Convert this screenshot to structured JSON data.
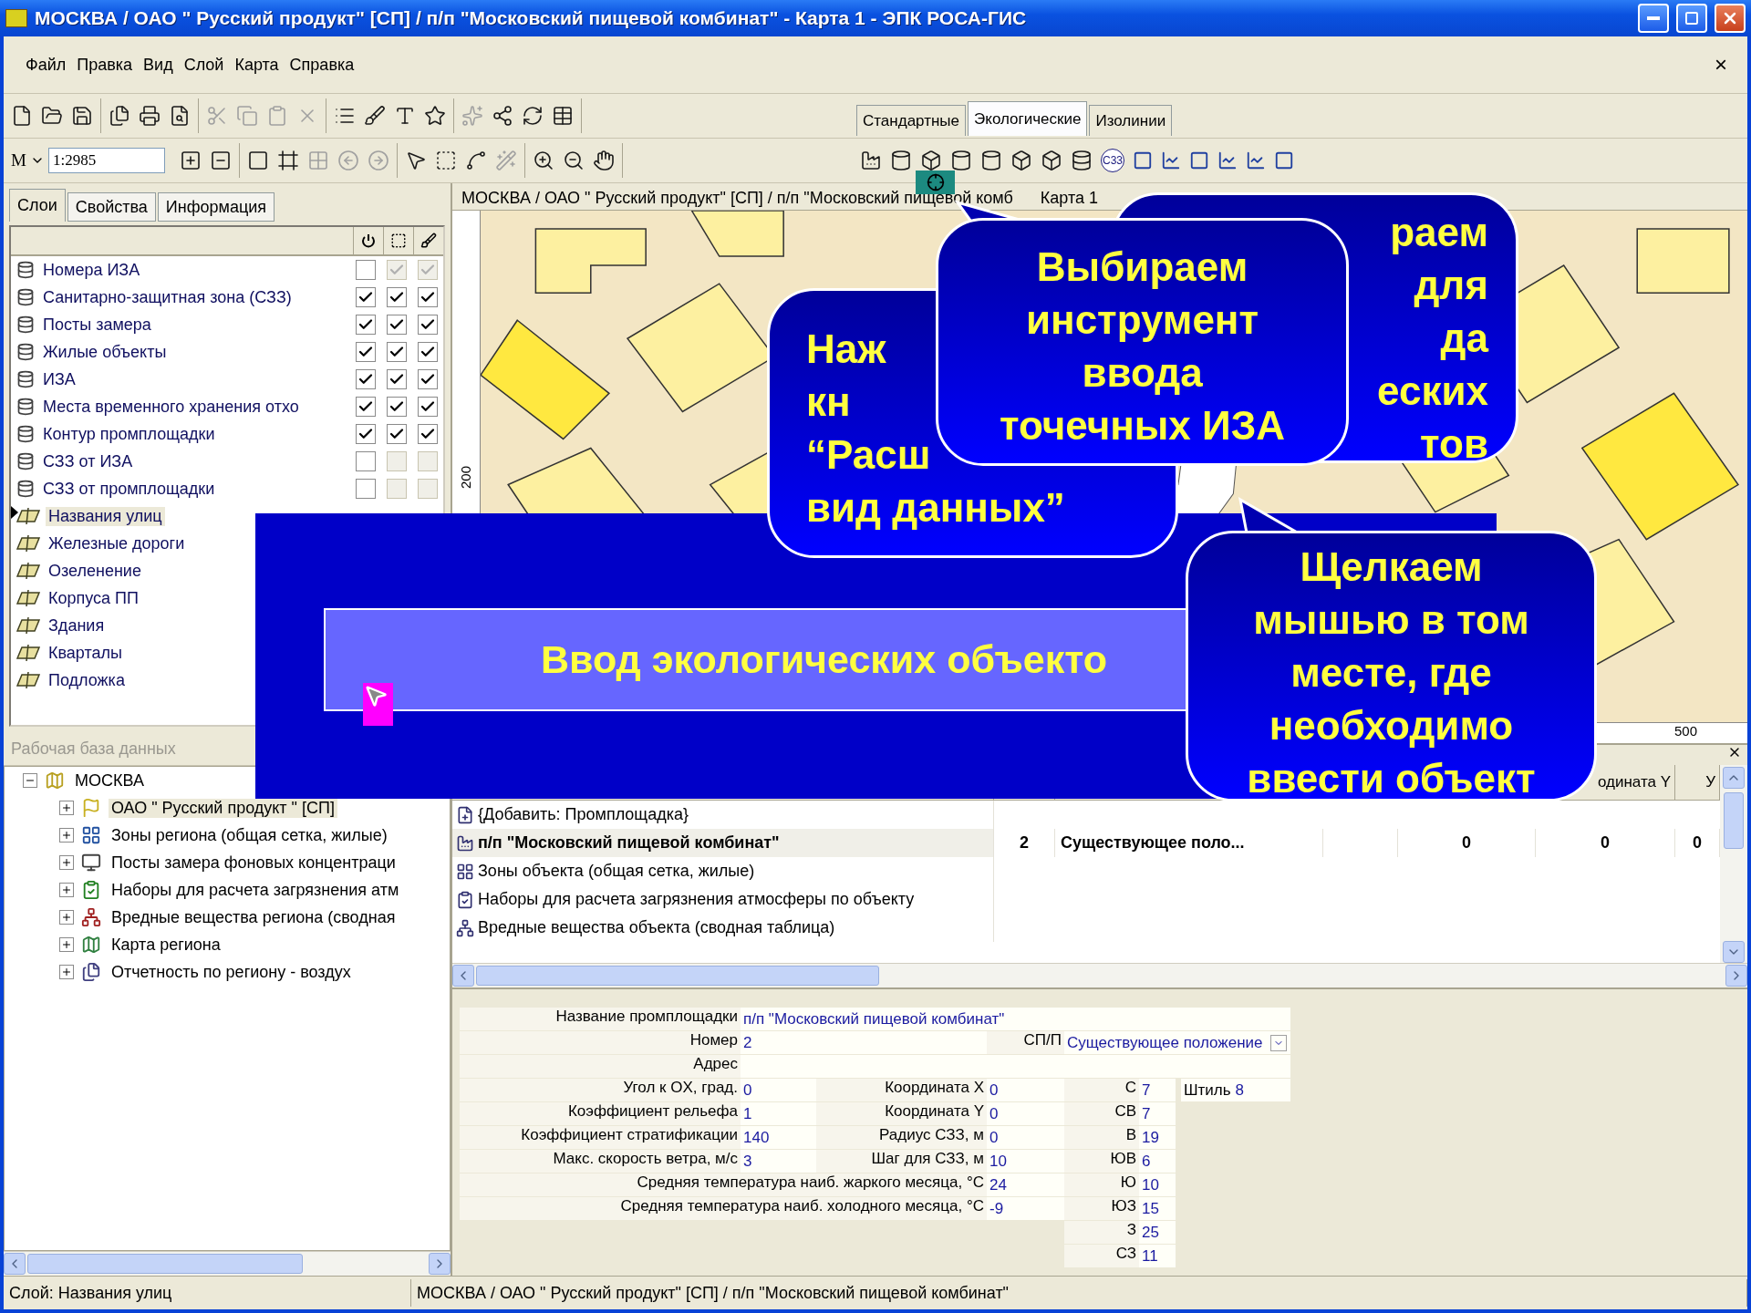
{
  "window": {
    "title": "МОСКВА / ОАО \" Русский продукт\"  [СП] / п/п \"Московский пищевой комбинат\"  -  Карта 1  -  ЭПК РОСА-ГИС"
  },
  "menu": [
    "Файл",
    "Правка",
    "Вид",
    "Слой",
    "Карта",
    "Справка"
  ],
  "menu_close": "×",
  "scale": {
    "unit": "M",
    "value": "1:2985"
  },
  "tool_tabs": [
    {
      "label": "Стандартные",
      "selected": false
    },
    {
      "label": "Экологические",
      "selected": true
    },
    {
      "label": "Изолинии",
      "selected": false
    }
  ],
  "eco_tool_label": "C33",
  "left_tabs": [
    {
      "label": "Слои",
      "selected": true
    },
    {
      "label": "Свойства",
      "selected": false
    },
    {
      "label": "Информация",
      "selected": false
    }
  ],
  "layers": [
    {
      "name": "Номера ИЗА",
      "kind": "db",
      "selected": false,
      "checks": [
        {
          "checked": false,
          "disabled": false
        },
        {
          "checked": true,
          "disabled": true
        },
        {
          "checked": true,
          "disabled": true
        }
      ]
    },
    {
      "name": "Санитарно-защитная зона (СЗЗ)",
      "kind": "db",
      "selected": false,
      "checks": [
        {
          "checked": true,
          "disabled": false
        },
        {
          "checked": true,
          "disabled": false
        },
        {
          "checked": true,
          "disabled": false
        }
      ]
    },
    {
      "name": "Посты замера",
      "kind": "db",
      "selected": false,
      "checks": [
        {
          "checked": true,
          "disabled": false
        },
        {
          "checked": true,
          "disabled": false
        },
        {
          "checked": true,
          "disabled": false
        }
      ]
    },
    {
      "name": "Жилые объекты",
      "kind": "db",
      "selected": false,
      "checks": [
        {
          "checked": true,
          "disabled": false
        },
        {
          "checked": true,
          "disabled": false
        },
        {
          "checked": true,
          "disabled": false
        }
      ]
    },
    {
      "name": "ИЗА",
      "kind": "db",
      "selected": false,
      "checks": [
        {
          "checked": true,
          "disabled": false
        },
        {
          "checked": true,
          "disabled": false
        },
        {
          "checked": true,
          "disabled": false
        }
      ]
    },
    {
      "name": "Места временного хранения отхо",
      "kind": "db",
      "selected": false,
      "checks": [
        {
          "checked": true,
          "disabled": false
        },
        {
          "checked": true,
          "disabled": false
        },
        {
          "checked": true,
          "disabled": false
        }
      ]
    },
    {
      "name": "Контур промплощадки",
      "kind": "db",
      "selected": false,
      "checks": [
        {
          "checked": true,
          "disabled": false
        },
        {
          "checked": true,
          "disabled": false
        },
        {
          "checked": true,
          "disabled": false
        }
      ]
    },
    {
      "name": "СЗЗ от ИЗА",
      "kind": "db",
      "selected": false,
      "checks": [
        {
          "checked": false,
          "disabled": false
        },
        {
          "checked": false,
          "disabled": true
        },
        {
          "checked": false,
          "disabled": true
        }
      ]
    },
    {
      "name": "СЗЗ от промплощадки",
      "kind": "db",
      "selected": false,
      "checks": [
        {
          "checked": false,
          "disabled": false
        },
        {
          "checked": false,
          "disabled": true
        },
        {
          "checked": false,
          "disabled": true
        }
      ]
    },
    {
      "name": "Названия улиц",
      "kind": "layer",
      "selected": true
    },
    {
      "name": "Железные дороги",
      "kind": "layer",
      "selected": false
    },
    {
      "name": "Озеленение",
      "kind": "layer",
      "selected": false
    },
    {
      "name": "Корпуса ПП",
      "kind": "layer",
      "selected": false
    },
    {
      "name": "Здания",
      "kind": "layer",
      "selected": false
    },
    {
      "name": "Кварталы",
      "kind": "layer",
      "selected": false
    },
    {
      "name": "Подложка",
      "kind": "layer",
      "selected": false
    }
  ],
  "database": {
    "title": "Рабочая база данных",
    "tree": [
      {
        "label": "МОСКВА",
        "kind": "region",
        "expanded": true,
        "selected": false,
        "children": [
          {
            "label": "ОАО \" Русский продукт \"  [СП]",
            "kind": "company",
            "expanded": false,
            "selected": true
          },
          {
            "label": "Зоны региона (общая сетка, жилые)",
            "kind": "zones",
            "expanded": false,
            "selected": false
          },
          {
            "label": "Посты замера фоновых концентраци",
            "kind": "posts",
            "expanded": false,
            "selected": false
          },
          {
            "label": "Наборы для расчета загрязнения атм",
            "kind": "sets",
            "expanded": false,
            "selected": false
          },
          {
            "label": "Вредные вещества региона (сводная",
            "kind": "substances",
            "expanded": false,
            "selected": false
          },
          {
            "label": "Карта региона",
            "kind": "map",
            "expanded": false,
            "selected": false
          },
          {
            "label": "Отчетность по региону - воздух",
            "kind": "reports",
            "expanded": false,
            "selected": false
          }
        ]
      }
    ]
  },
  "map": {
    "title": "МОСКВА / ОАО \" Русский продукт\"  [СП] / п/п \"Московский пищевой комб",
    "title_tail": "Карта 1",
    "ruler_labels": [
      "200",
      "500"
    ]
  },
  "table": {
    "headers": [
      "одината Y",
      "У"
    ],
    "rows": [
      {
        "kind": "add",
        "bold": false,
        "cells": [
          "{Добавить: Промплощадка}"
        ]
      },
      {
        "kind": "site",
        "bold": true,
        "cells": [
          "п/п \"Московский пищевой комбинат\"",
          "2",
          "Существующее поло...",
          "0",
          "0",
          "0"
        ]
      },
      {
        "kind": "zones",
        "bold": false,
        "cells": [
          "Зоны объекта (общая сетка, жилые)"
        ]
      },
      {
        "kind": "sets",
        "bold": false,
        "cells": [
          "Наборы для расчета загрязнения атмосферы по объекту"
        ]
      },
      {
        "kind": "substances",
        "bold": false,
        "cells": [
          "Вредные вещества объекта (сводная таблица)"
        ]
      }
    ]
  },
  "properties": {
    "name": {
      "label": "Название промплощадки",
      "value": "п/п \"Московский пищевой комбинат\""
    },
    "number": {
      "label": "Номер",
      "value": "2"
    },
    "sp": {
      "label": "СП/П",
      "value": "Существующее положение"
    },
    "address": {
      "label": "Адрес"
    },
    "left": [
      {
        "label": "Угол  к  OX, град.",
        "value": "0"
      },
      {
        "label": "Коэффициент рельефа",
        "value": "1"
      },
      {
        "label": "Коэффициент стратификации",
        "value": "140"
      },
      {
        "label": "Макс. скорость ветра, м/с",
        "value": "3"
      }
    ],
    "middle": [
      {
        "label": "Координата X",
        "value": "0"
      },
      {
        "label": "Координата Y",
        "value": "0"
      },
      {
        "label": "Радиус СЗЗ, м",
        "value": "0"
      },
      {
        "label": "Шаг для СЗЗ, м",
        "value": "10"
      }
    ],
    "temps": [
      {
        "label": "Средняя температура наиб. жаркого месяца, °C",
        "value": "24"
      },
      {
        "label": "Средняя температура наиб. холодного месяца, °C",
        "value": "-9"
      }
    ],
    "wind": [
      {
        "label": "С",
        "value": "7"
      },
      {
        "label": "СВ",
        "value": "7"
      },
      {
        "label": "В",
        "value": "19"
      },
      {
        "label": "ЮВ",
        "value": "6"
      },
      {
        "label": "Ю",
        "value": "10"
      },
      {
        "label": "ЮЗ",
        "value": "15"
      },
      {
        "label": "З",
        "value": "25"
      },
      {
        "label": "СЗ",
        "value": "11"
      }
    ],
    "calm": {
      "label": "Штиль",
      "value": "8"
    }
  },
  "slide": {
    "banner": "Ввод экологических объекто"
  },
  "callouts": [
    {
      "kind": "back-left",
      "lines": [
        "Наж",
        "кн",
        "“Расш",
        "вид данных”"
      ]
    },
    {
      "kind": "front",
      "lines": [
        "Выбираем",
        "инструмент",
        "ввода",
        "точечных ИЗА"
      ]
    },
    {
      "kind": "back-right",
      "lines": [
        "раем",
        "для",
        "да",
        "еских",
        "тов"
      ]
    },
    {
      "kind": "bottom",
      "lines": [
        "Щелкаем",
        "мышью в том",
        "месте, где",
        "необходимо",
        "ввести объект"
      ]
    }
  ],
  "status_bar": {
    "layer": "Слой: Названия улиц",
    "path": "МОСКВА / ОАО \" Русский продукт\"  [СП] / п/п \"Московский пищевой комбинат\""
  }
}
